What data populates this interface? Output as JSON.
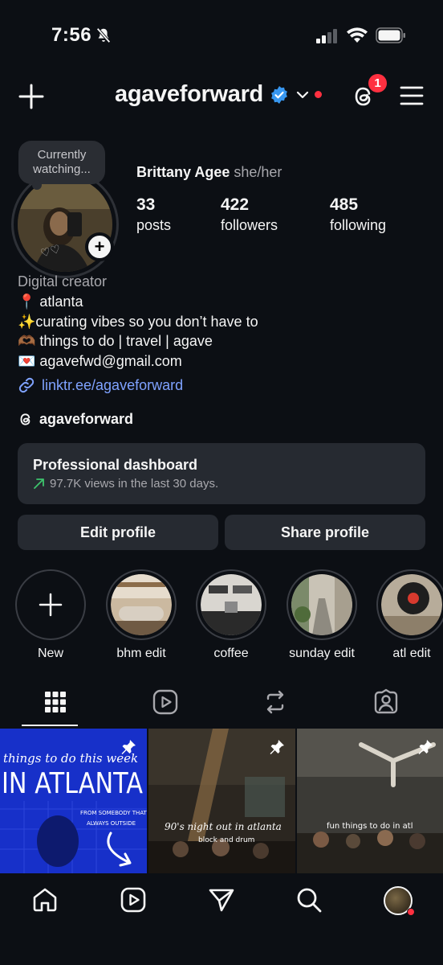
{
  "status_bar": {
    "time": "7:56"
  },
  "header": {
    "username": "agaveforward",
    "threads_badge_count": "1"
  },
  "profile": {
    "note": "Currently watching...",
    "display_name": "Brittany Agee",
    "pronouns": "she/her",
    "stats": [
      {
        "value": "33",
        "label": "posts"
      },
      {
        "value": "422",
        "label": "followers"
      },
      {
        "value": "485",
        "label": "following"
      }
    ],
    "category": "Digital creator",
    "bio_lines": [
      "📍 atlanta",
      "✨curating vibes so you don’t have to",
      "🫶🏾 things to do | travel | agave",
      "💌 agavefwd@gmail.com"
    ],
    "link": "linktr.ee/agaveforward",
    "threads_handle": "agaveforward"
  },
  "dashboard": {
    "title": "Professional dashboard",
    "subtitle": "97.7K views in the last 30 days."
  },
  "actions": {
    "edit_label": "Edit profile",
    "share_label": "Share profile"
  },
  "highlights": [
    {
      "label": "New"
    },
    {
      "label": "bhm edit"
    },
    {
      "label": "coffee"
    },
    {
      "label": "sunday edit"
    },
    {
      "label": "atl edit"
    }
  ],
  "tabs": [
    "posts-grid-icon",
    "reels-icon",
    "reposts-icon",
    "tagged-icon"
  ],
  "posts": [
    {
      "line1": "things to do this week",
      "line2": "IN ATLANTA",
      "line3": "FROM SOMEBODY THAT IS",
      "line4": "ALWAYS OUTSIDE"
    },
    {
      "line1": "90's night out in atlanta",
      "line2": "block and drum"
    },
    {
      "line1": "fun things to do in atl"
    }
  ],
  "colors": {
    "background": "#0c0f14",
    "card": "#262a31",
    "link": "#7fa2ff",
    "badge": "#ff3040",
    "verified": "#3897f0"
  }
}
